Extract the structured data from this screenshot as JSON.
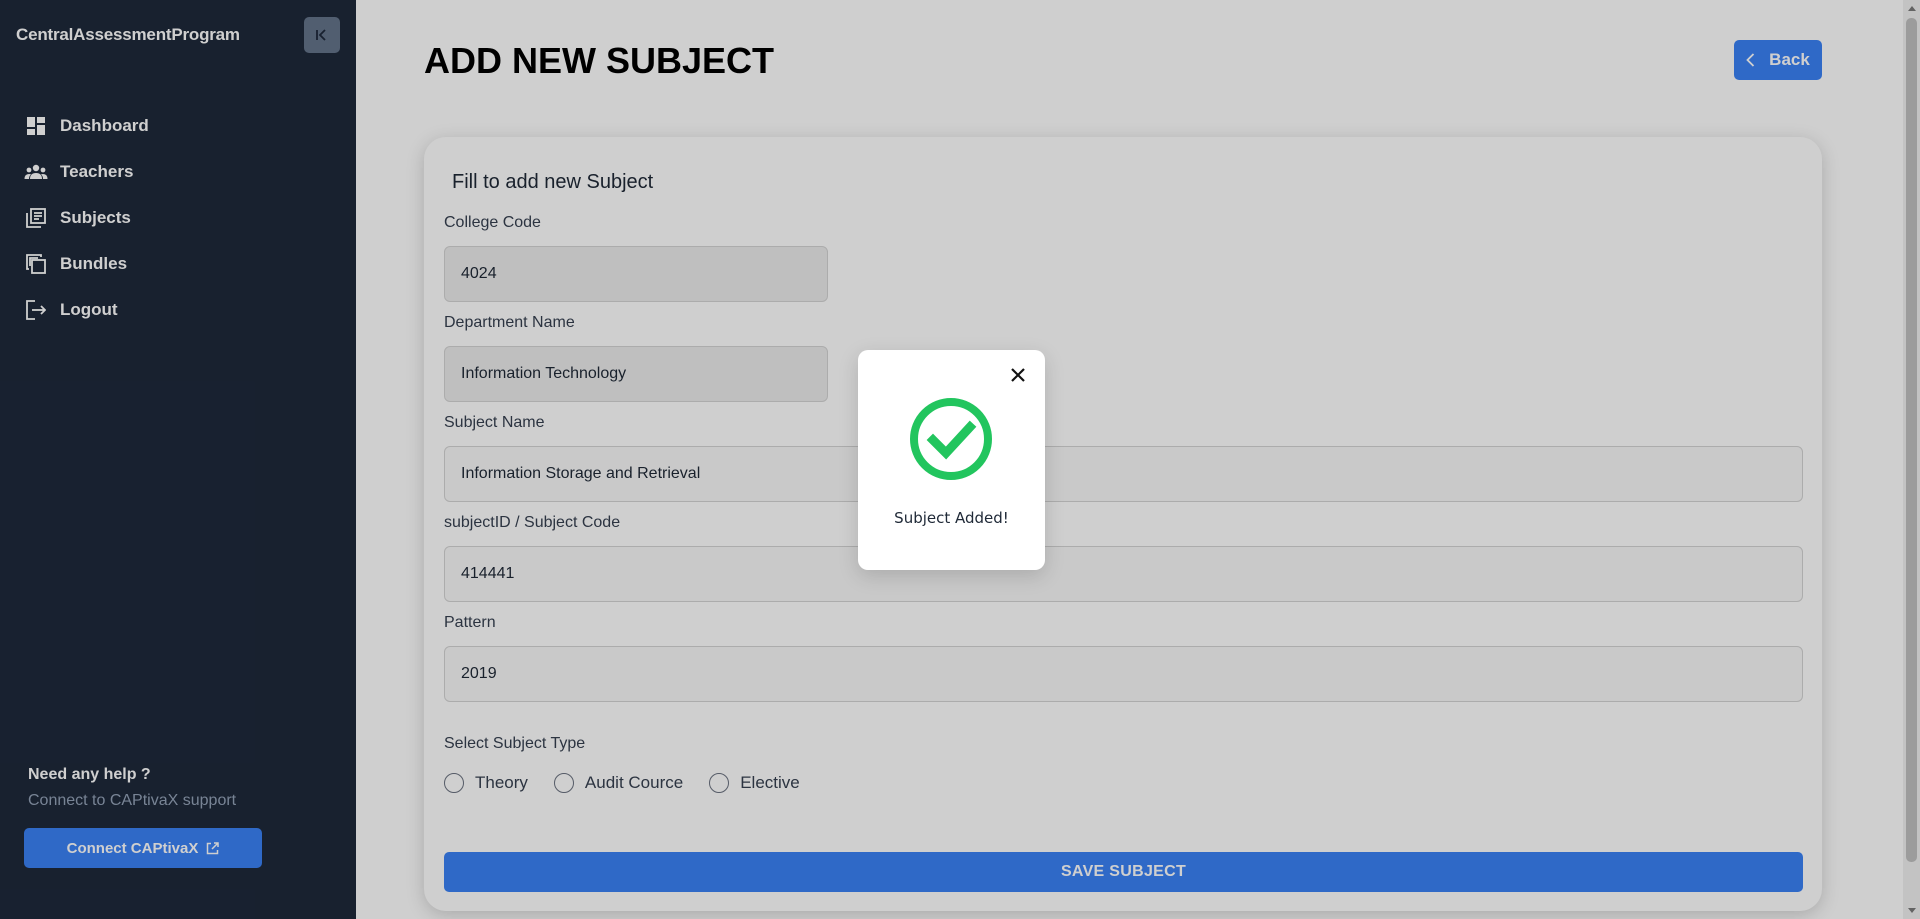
{
  "app": {
    "brand": "CentralAssessmentProgram"
  },
  "sidebar": {
    "collapse_icon": "collapse-left-icon",
    "items": [
      {
        "label": "Dashboard",
        "icon": "dashboard-icon"
      },
      {
        "label": "Teachers",
        "icon": "people-icon"
      },
      {
        "label": "Subjects",
        "icon": "library-books-icon"
      },
      {
        "label": "Bundles",
        "icon": "file-copy-icon"
      },
      {
        "label": "Logout",
        "icon": "logout-icon"
      }
    ],
    "help": {
      "title": "Need any help ?",
      "subtitle": "Connect to CAPtivaX support",
      "button_label": "Connect CAPtivaX"
    }
  },
  "header": {
    "title": "ADD NEW SUBJECT",
    "back_label": "Back"
  },
  "form": {
    "heading": "Fill to add new Subject",
    "fields": {
      "college_code": {
        "label": "College Code",
        "value": "4024"
      },
      "department_name": {
        "label": "Department Name",
        "value": "Information Technology"
      },
      "subject_name": {
        "label": "Subject Name",
        "value": "Information Storage and Retrieval"
      },
      "subject_code": {
        "label": "subjectID / Subject Code",
        "value": "414441"
      },
      "pattern": {
        "label": "Pattern",
        "value": "2019"
      }
    },
    "subject_type": {
      "label": "Select Subject Type",
      "options": [
        "Theory",
        "Audit Cource",
        "Elective"
      ],
      "selected": null
    },
    "save_label": "SAVE SUBJECT"
  },
  "modal": {
    "message": "Subject Added!",
    "icon": "check-circle-icon",
    "close_icon": "close-icon"
  },
  "colors": {
    "sidebar_bg": "#1e293b",
    "accent": "#3b82f6",
    "success": "#22c55e"
  }
}
